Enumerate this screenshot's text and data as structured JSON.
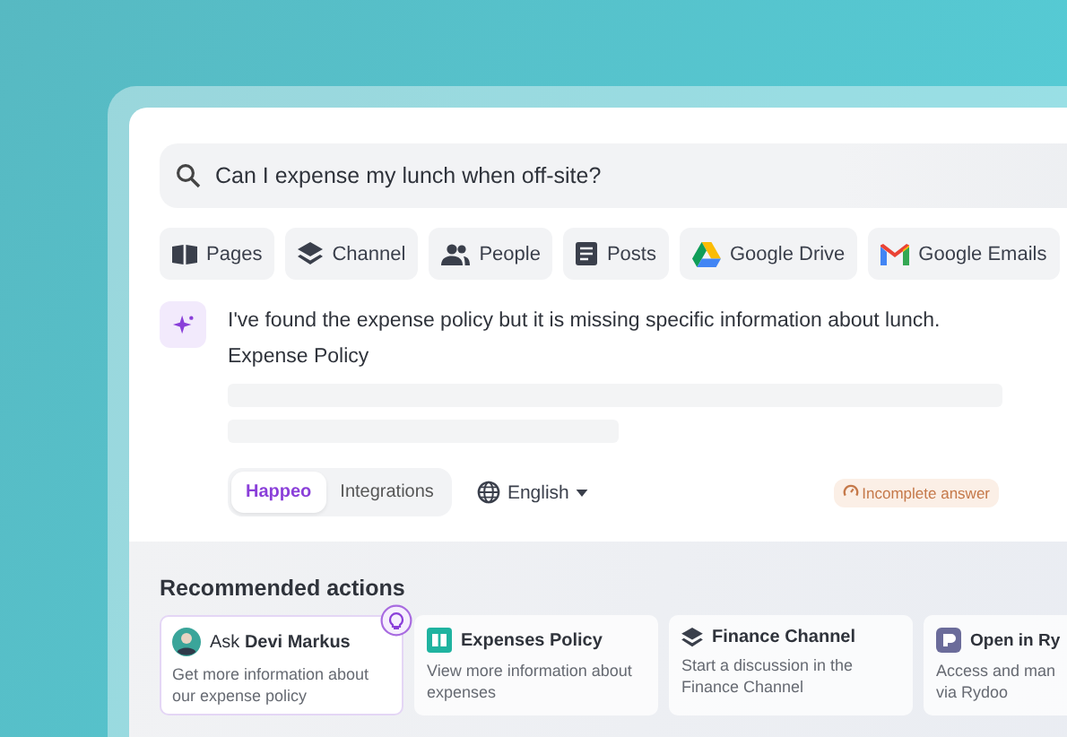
{
  "search": {
    "value": "Can I expense my lunch when off-site?"
  },
  "filters": [
    {
      "label": "Pages",
      "kind": "pages"
    },
    {
      "label": "Channel",
      "kind": "channel"
    },
    {
      "label": "People",
      "kind": "people"
    },
    {
      "label": "Posts",
      "kind": "posts"
    },
    {
      "label": "Google Drive",
      "kind": "drive"
    },
    {
      "label": "Google Emails",
      "kind": "gmail"
    }
  ],
  "answer": {
    "text": "I've found the expense policy but it is missing specific information about lunch.",
    "source": "Expense Policy",
    "sources": [
      {
        "label": "Happeo",
        "selected": true
      },
      {
        "label": "Integrations",
        "selected": false
      }
    ],
    "language": "English",
    "status": "Incomplete answer"
  },
  "recommended": {
    "title": "Recommended actions",
    "cards": [
      {
        "kind": "person",
        "title": "Ask **Devi Markus**",
        "description": "Get more information about our expense policy",
        "selected": true
      },
      {
        "kind": "page",
        "title": "Expenses Policy",
        "description": "View more information about expenses",
        "selected": false
      },
      {
        "kind": "channel",
        "title": "Finance Channel",
        "description": "Start a discussion in the Finance Channel",
        "selected": false
      },
      {
        "kind": "app",
        "title": "Open in Ry",
        "description": "Access and man via Rydoo",
        "selected": false
      }
    ]
  }
}
